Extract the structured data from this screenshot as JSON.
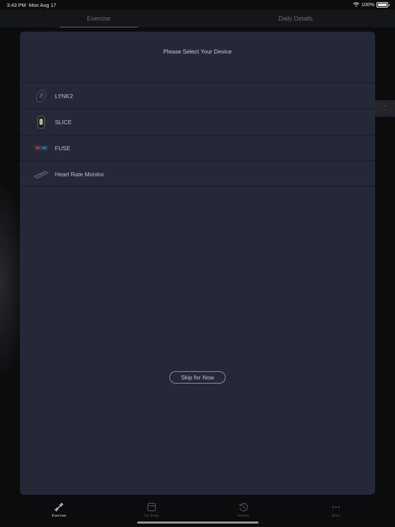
{
  "status_bar": {
    "time": "3:43 PM",
    "date": "Mon Aug 17",
    "battery": "100%",
    "battery_level": 1.0
  },
  "top_tabs": [
    {
      "label": "Exercise",
      "active": true
    },
    {
      "label": "Daily Details",
      "active": false
    }
  ],
  "modal": {
    "title": "Please Select Your Device",
    "devices": [
      {
        "label": "LYNK2",
        "icon": "lynk2-device-icon"
      },
      {
        "label": "SLICE",
        "icon": "slice-device-icon"
      },
      {
        "label": "FUSE",
        "icon": "fuse-device-icon"
      },
      {
        "label": "Heart Rate Monitor",
        "icon": "heart-rate-monitor-icon"
      }
    ],
    "skip_label": "Skip for Now"
  },
  "tab_bar": [
    {
      "label": "Exercise",
      "icon": "exercise-icon",
      "active": true
    },
    {
      "label": "My Body",
      "icon": "my-body-icon",
      "active": false
    },
    {
      "label": "History",
      "icon": "history-icon",
      "active": false
    },
    {
      "label": "More",
      "icon": "more-icon",
      "active": false
    }
  ],
  "colors": {
    "modal_bg": "#252937",
    "app_bg": "#0c0c0d",
    "active_tab": "#c8cbd1",
    "inactive_tab": "#4d5057"
  }
}
